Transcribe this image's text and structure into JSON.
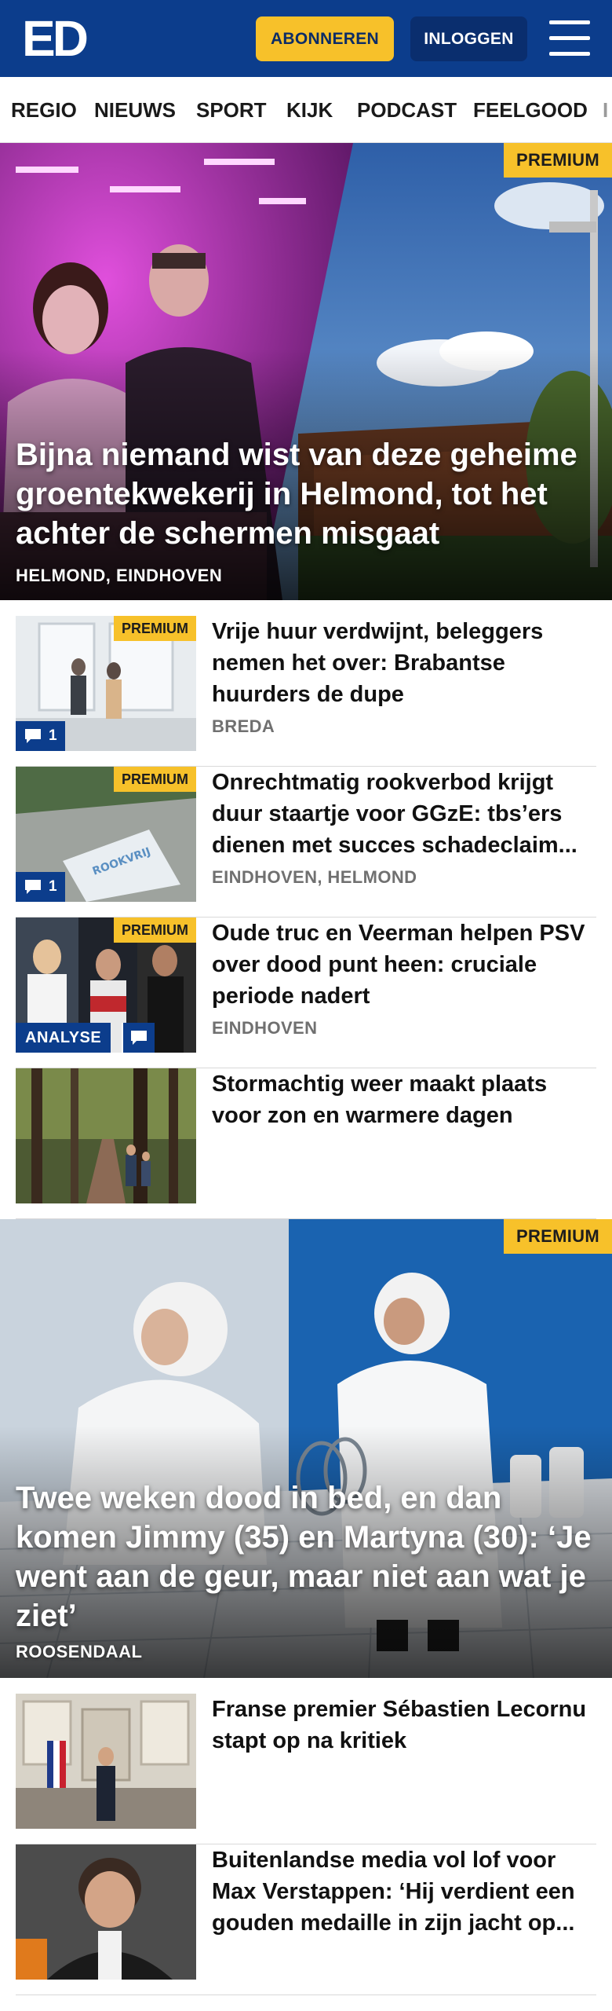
{
  "header": {
    "logo": "ED",
    "subscribe_label": "ABONNEREN",
    "login_label": "INLOGGEN"
  },
  "nav": {
    "items": [
      "REGIO",
      "NIEUWS",
      "SPORT",
      "KIJK",
      "PODCAST",
      "FEELGOOD",
      "I"
    ]
  },
  "colors": {
    "brand_blue": "#0c3d8c",
    "premium_yellow": "#f7c12a"
  },
  "hero1": {
    "badge": "PREMIUM",
    "title": "Bijna niemand wist van deze geheime groentekwekerij in Helmond, tot het achter de schermen misgaat",
    "location": "HELMOND, EINDHOVEN"
  },
  "articles": [
    {
      "badge": "PREMIUM",
      "comments": "1",
      "title": "Vrije huur verdwijnt, beleggers nemen het over: Brabantse huurders de dupe",
      "location": "BREDA"
    },
    {
      "badge": "PREMIUM",
      "comments": "1",
      "title": "Onrechtmatig rookverbod krijgt duur staartje voor GGzE: tbs’ers dienen met succes schadeclaim...",
      "location": "EINDHOVEN, HELMOND"
    },
    {
      "badge": "PREMIUM",
      "label": "ANALYSE",
      "title": "Oude truc en Veerman helpen PSV over dood punt heen: cruciale periode nadert",
      "location": "EINDHOVEN"
    },
    {
      "title": "Stormachtig weer maakt plaats voor zon en warmere dagen"
    }
  ],
  "hero2": {
    "badge": "PREMIUM",
    "title": "Twee weken dood in bed, en dan komen Jimmy (35) en Martyna (30): ‘Je went aan de geur, maar niet aan wat je ziet’",
    "location": "ROOSENDAAL"
  },
  "articles2": [
    {
      "title": "Franse premier Sébastien Lecornu stapt op na kritiek"
    },
    {
      "title": "Buitenlandse media vol lof voor Max Verstappen: ‘Hij verdient een gouden medaille in zijn jacht op..."
    }
  ]
}
